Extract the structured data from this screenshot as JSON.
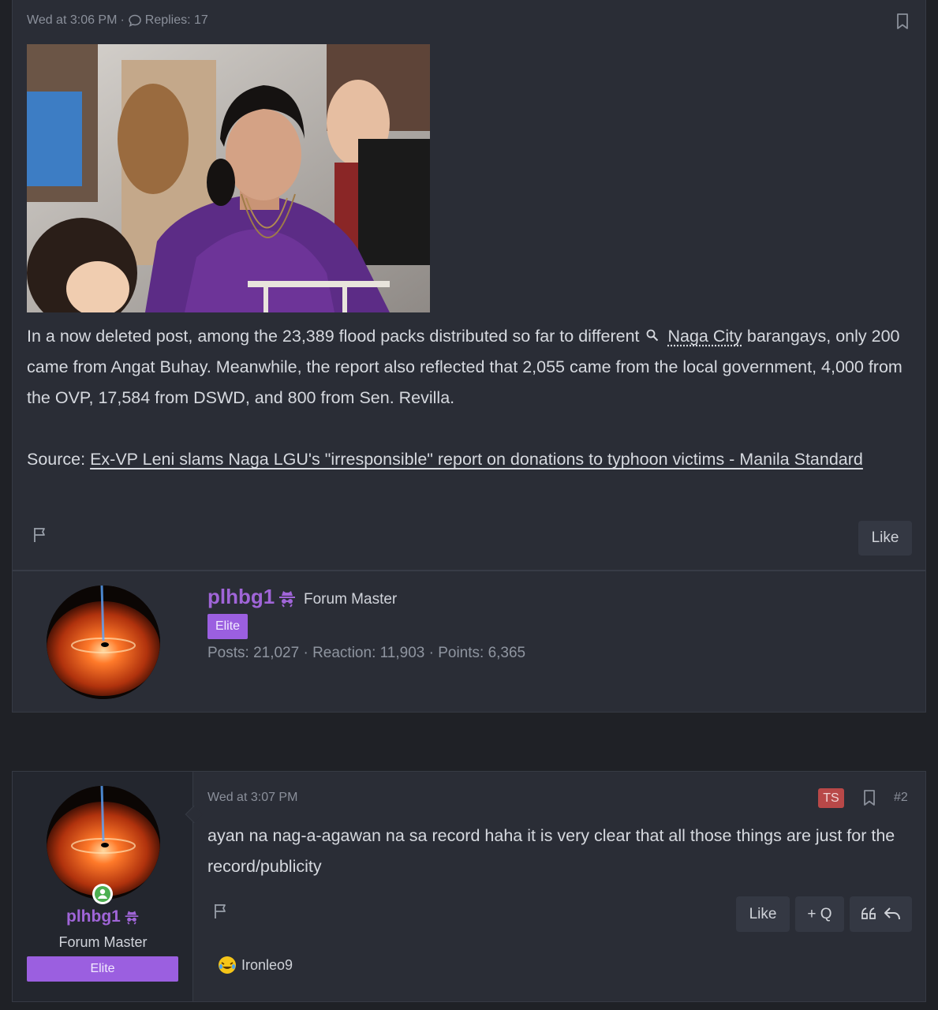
{
  "post1": {
    "timestamp": "Wed at 3:06 PM",
    "separator": "·",
    "replies": "Replies: 17",
    "body_line1_prefix": "In a now deleted post, among the 23,389 flood packs distributed so far to different",
    "body_line1_link": "Naga City",
    "body_rest": "barangays, only 200 came from Angat Buhay. Meanwhile, the report also reflected that 2,055 came from the local government, 4,000 from the OVP, 17,584 from DSWD, and 800 from Sen. Revilla.",
    "source_label": "Source:",
    "source_link": "Ex-VP Leni slams Naga LGU's \"irresponsible\" report on donations to typhoon victims - Manila Standard",
    "like_label": "Like"
  },
  "author1": {
    "username": "plhbg1",
    "title": "Forum Master",
    "badge": "Elite",
    "stats": "Posts: 21,027 · Reaction: 11,903 · Points: 6,365"
  },
  "post2": {
    "username": "plhbg1",
    "title": "Forum Master",
    "badge": "Elite",
    "timestamp": "Wed at 3:07 PM",
    "ts_badge": "TS",
    "post_number": "#2",
    "body": "ayan na nag-a-agawan na sa record haha it is very clear that all those things are just for the record/publicity",
    "like_label": "Like",
    "quote_label": "+ Q",
    "reactor": "Ironleo9"
  }
}
